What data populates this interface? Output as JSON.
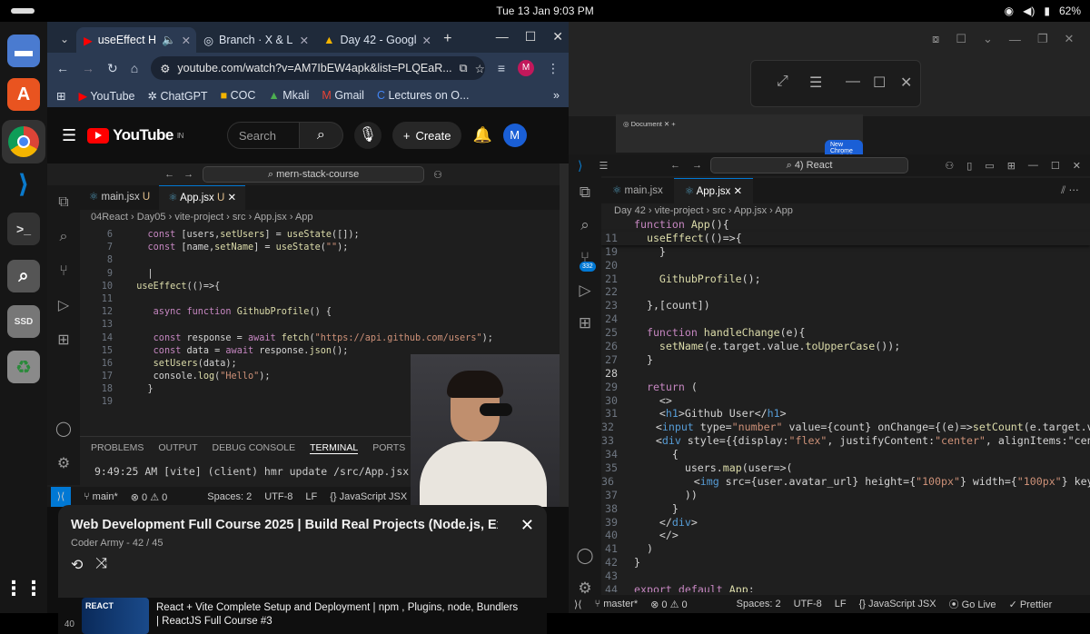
{
  "system": {
    "clock": "Tue 13 Jan   9:03 PM",
    "battery": "62%"
  },
  "browser": {
    "tabs": [
      {
        "label": "useEffect H",
        "icon": "youtube-icon"
      },
      {
        "label": "Branch · X & L",
        "icon": "globe-icon"
      },
      {
        "label": "Day 42 - Googl",
        "icon": "drive-icon"
      }
    ],
    "url": "youtube.com/watch?v=AM7IbEW4apk&list=PLQEaR...",
    "bookmarks": [
      "YouTube",
      "ChatGPT",
      "COC",
      "Mkali",
      "Gmail",
      "Lectures on O..."
    ]
  },
  "youtube": {
    "logo": "YouTube",
    "region": "IN",
    "search_placeholder": "Search",
    "create_label": "Create",
    "avatar_letter": "M",
    "playlist": {
      "title": "Web Development Full Course 2025 | Build Real Projects (Node.js, Ex...",
      "subtitle": "Coder Army - 42 / 45",
      "item_num": "40",
      "item_title": "React + Vite Complete Setup and Deployment | npm , Plugins, node, Bundlers | ReactJS Full Course #3",
      "thumb_text": "REACT"
    }
  },
  "video_vscode": {
    "command_center": "mern-stack-course",
    "tabs": [
      {
        "label": "main.jsx",
        "badge": "U"
      },
      {
        "label": "App.jsx",
        "badge": "U"
      }
    ],
    "breadcrumb": "04React  ›  Day05  ›  vite-project  ›  src  ›  App.jsx  ›  App",
    "lines": [
      {
        "n": "6",
        "code": "    const [users,setUsers] = useState([]);"
      },
      {
        "n": "7",
        "code": "    const [name,setName] = useState(\"\");"
      },
      {
        "n": "8",
        "code": ""
      },
      {
        "n": "9",
        "code": "    |"
      },
      {
        "n": "10",
        "code": "  useEffect(()=>{"
      },
      {
        "n": "11",
        "code": ""
      },
      {
        "n": "12",
        "code": "     async function GithubProfile() {"
      },
      {
        "n": "13",
        "code": ""
      },
      {
        "n": "14",
        "code": "     const response = await fetch(\"https://api.github.com/users\");"
      },
      {
        "n": "15",
        "code": "     const data = await response.json();"
      },
      {
        "n": "16",
        "code": "     setUsers(data);"
      },
      {
        "n": "17",
        "code": "     console.log(\"Hello\");"
      },
      {
        "n": "18",
        "code": "    }"
      },
      {
        "n": "19",
        "code": ""
      }
    ],
    "panel_tabs": [
      "PROBLEMS",
      "OUTPUT",
      "DEBUG CONSOLE",
      "TERMINAL",
      "PORTS"
    ],
    "terminal": "9:49:25 AM [vite] (client) hmr update /src/App.jsx (x5)",
    "status": {
      "branch": "main*",
      "errors": "⊗ 0 ⚠ 0",
      "spaces": "Spaces: 2",
      "enc": "UTF-8",
      "eol": "LF",
      "lang": "JavaScript JSX"
    }
  },
  "right": {
    "chrome_tab": "Document",
    "new_chrome": "New Chrome available",
    "vscode": {
      "search": "4) React",
      "scm_badge": "332",
      "tabs": [
        "main.jsx",
        "App.jsx"
      ],
      "breadcrumb": "Day 42  ›  vite-project  ›  src  ›  App.jsx  ›  App",
      "sticky": [
        {
          "n": "",
          "code": "function App(){"
        },
        {
          "n": "11",
          "code": "  useEffect(()=>{"
        }
      ],
      "lines": [
        {
          "n": "19",
          "code": "    }"
        },
        {
          "n": "20",
          "code": ""
        },
        {
          "n": "21",
          "code": "    GithubProfile();"
        },
        {
          "n": "22",
          "code": ""
        },
        {
          "n": "23",
          "code": "  },[count])"
        },
        {
          "n": "24",
          "code": ""
        },
        {
          "n": "25",
          "code": "  function handleChange(e){"
        },
        {
          "n": "26",
          "code": "    setName(e.target.value.toUpperCase());"
        },
        {
          "n": "27",
          "code": "  }"
        },
        {
          "n": "28",
          "code": ""
        },
        {
          "n": "29",
          "code": "  return ("
        },
        {
          "n": "30",
          "code": "    <>"
        },
        {
          "n": "31",
          "code": "    <h1>Github User</h1>"
        },
        {
          "n": "32",
          "code": "    <input type=\"number\" value={count} onChange={(e)=>setCount(e.target.v"
        },
        {
          "n": "33",
          "code": "    <div style={{display:\"flex\", justifyContent:\"center\", alignItems:\"cen"
        },
        {
          "n": "34",
          "code": "      {"
        },
        {
          "n": "35",
          "code": "        users.map(user=>("
        },
        {
          "n": "36",
          "code": "          <img src={user.avatar_url} height={\"100px\"} width={\"100px\"} key"
        },
        {
          "n": "37",
          "code": "        ))"
        },
        {
          "n": "38",
          "code": "      }"
        },
        {
          "n": "39",
          "code": "    </div>"
        },
        {
          "n": "40",
          "code": "    </>"
        },
        {
          "n": "41",
          "code": "  )"
        },
        {
          "n": "42",
          "code": "}"
        },
        {
          "n": "43",
          "code": ""
        },
        {
          "n": "44",
          "code": "export default App;"
        }
      ],
      "status": {
        "branch": "master*",
        "errors": "⊗ 0 ⚠ 0",
        "spaces": "Spaces: 2",
        "enc": "UTF-8",
        "eol": "LF",
        "lang": "JavaScript JSX",
        "golive": "Go Live",
        "prettier": "Prettier"
      }
    }
  }
}
